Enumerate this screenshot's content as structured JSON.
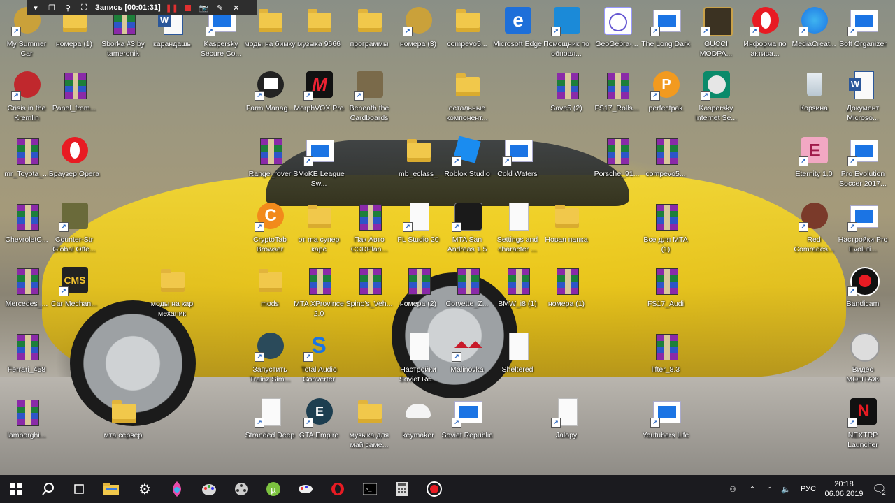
{
  "recorder": {
    "title": "Запись [00:01:31]",
    "icons": [
      "chevron-down-icon",
      "restore-window-icon",
      "search-icon",
      "region-select-icon",
      "pause-icon",
      "stop-icon",
      "camera-icon",
      "pen-icon",
      "close-icon"
    ]
  },
  "icons": [
    {
      "id": "my-summer-car",
      "label": "My Summer Car",
      "icon": "game-icon",
      "col": 0,
      "row": 0,
      "shortcut": true
    },
    {
      "id": "nomera-1",
      "label": "номера (1)",
      "icon": "folder",
      "col": 1,
      "row": 0
    },
    {
      "id": "sborka-3",
      "label": "Sborka #3 by tameronik",
      "icon": "winrar",
      "col": 2,
      "row": 0
    },
    {
      "id": "karandash",
      "label": "карандашь",
      "icon": "word",
      "col": 3,
      "row": 0
    },
    {
      "id": "kaspersky-secure",
      "label": "Kaspersky Secure Co...",
      "icon": "appwin",
      "col": 4,
      "row": 0,
      "shortcut": true
    },
    {
      "id": "mody-na-bimku",
      "label": "моды на бимку",
      "icon": "folder",
      "col": 5,
      "row": 0
    },
    {
      "id": "muzyka-9666",
      "label": "музыка 9666",
      "icon": "folder",
      "col": 6,
      "row": 0
    },
    {
      "id": "programmy",
      "label": "программы",
      "icon": "folder",
      "col": 7,
      "row": 0
    },
    {
      "id": "nomera-3",
      "label": "номера (3)",
      "icon": "game-icon",
      "col": 8,
      "row": 0,
      "shortcut": true
    },
    {
      "id": "compevo5-a",
      "label": "compevo5...",
      "icon": "folder",
      "col": 9,
      "row": 0
    },
    {
      "id": "edge",
      "label": "Microsoft Edge",
      "icon": "edge",
      "col": 10,
      "row": 0
    },
    {
      "id": "pomoshchnik",
      "label": "Помощник по обновл...",
      "icon": "windows",
      "col": 11,
      "row": 0,
      "shortcut": true
    },
    {
      "id": "geogebra",
      "label": "GeoGebra-...",
      "icon": "geogebra",
      "col": 12,
      "row": 0
    },
    {
      "id": "long-dark",
      "label": "The Long Dark",
      "icon": "appwin",
      "col": 13,
      "row": 0,
      "shortcut": true
    },
    {
      "id": "gucci",
      "label": "GUCCI MODPA...",
      "icon": "gucci",
      "col": 14,
      "row": 0,
      "shortcut": true
    },
    {
      "id": "informa",
      "label": "Информа по актива...",
      "icon": "opera",
      "col": 15,
      "row": 0,
      "shortcut": true
    },
    {
      "id": "mediacreation",
      "label": "MediaCreat...",
      "icon": "mediacreation",
      "col": 16,
      "row": 0,
      "shortcut": true
    },
    {
      "id": "soft-organizer",
      "label": "Soft Organizer",
      "icon": "appwin",
      "col": 17,
      "row": 0,
      "shortcut": true
    },
    {
      "id": "crisis-kremlin",
      "label": "Crisis in the Kremlin",
      "icon": "red-round",
      "col": 0,
      "row": 1,
      "shortcut": true
    },
    {
      "id": "panel-from",
      "label": "Panel_from...",
      "icon": "winrar",
      "col": 1,
      "row": 1
    },
    {
      "id": "farm-manager",
      "label": "Farm Manag...",
      "icon": "farm",
      "col": 5,
      "row": 1,
      "shortcut": true
    },
    {
      "id": "morphvox",
      "label": "MorphVOX Pro",
      "icon": "morphvox",
      "col": 6,
      "row": 1,
      "shortcut": true
    },
    {
      "id": "beneath-cardboards",
      "label": "Beneath the Cardboards",
      "icon": "cardboard",
      "col": 7,
      "row": 1,
      "shortcut": true
    },
    {
      "id": "ostalnye",
      "label": "остальные компонент...",
      "icon": "folder",
      "col": 9,
      "row": 1
    },
    {
      "id": "save5-2",
      "label": "Save5 (2)",
      "icon": "winrar",
      "col": 11,
      "row": 1
    },
    {
      "id": "fs17-rolls",
      "label": "FS17_Rolls...",
      "icon": "winrar",
      "col": 12,
      "row": 1
    },
    {
      "id": "perfectpak",
      "label": "perfectpak",
      "icon": "perfectpak",
      "col": 13,
      "row": 1,
      "shortcut": true
    },
    {
      "id": "kaspersky-is",
      "label": "Kaspersky Internet Se...",
      "icon": "kaspersky",
      "col": 14,
      "row": 1,
      "shortcut": true
    },
    {
      "id": "korzina",
      "label": "Корзина",
      "icon": "recycle",
      "col": 16,
      "row": 1
    },
    {
      "id": "dokument",
      "label": "Документ Microso...",
      "icon": "word",
      "col": 17,
      "row": 1
    },
    {
      "id": "mr-toyota",
      "label": "mr_Toyota_...",
      "icon": "winrar",
      "col": 0,
      "row": 2
    },
    {
      "id": "opera-browser",
      "label": "Браузер Opera",
      "icon": "opera",
      "col": 1,
      "row": 2
    },
    {
      "id": "range-rover",
      "label": "Range_rover",
      "icon": "winrar",
      "col": 5,
      "row": 2
    },
    {
      "id": "smoke-league",
      "label": "SMoKE League Sw...",
      "icon": "appwin",
      "col": 6,
      "row": 2,
      "shortcut": true
    },
    {
      "id": "mb-eclass",
      "label": "mb_eclass_",
      "icon": "folder",
      "col": 8,
      "row": 2
    },
    {
      "id": "roblox",
      "label": "Roblox Studio",
      "icon": "roblox",
      "col": 9,
      "row": 2,
      "shortcut": true
    },
    {
      "id": "cold-waters",
      "label": "Cold Waters",
      "icon": "appwin",
      "col": 10,
      "row": 2,
      "shortcut": true
    },
    {
      "id": "porsche-91",
      "label": "Porsche_91...",
      "icon": "winrar",
      "col": 12,
      "row": 2
    },
    {
      "id": "compevo5-b",
      "label": "compevo5...",
      "icon": "winrar",
      "col": 13,
      "row": 2
    },
    {
      "id": "eternity",
      "label": "Eternity 1.0",
      "icon": "eternity",
      "col": 16,
      "row": 2,
      "shortcut": true
    },
    {
      "id": "pes-2017",
      "label": "Pro Evolution Soccer 2017...",
      "icon": "appwin",
      "col": 17,
      "row": 2,
      "shortcut": true
    },
    {
      "id": "chevrolet",
      "label": "ChevroletC...",
      "icon": "winrar",
      "col": 0,
      "row": 3
    },
    {
      "id": "counter-strike",
      "label": "Counter-Str Global Offe...",
      "icon": "csgo",
      "col": 1,
      "row": 3,
      "shortcut": true
    },
    {
      "id": "cryptotab",
      "label": "CryptoTab Browser",
      "icon": "cryptotab",
      "col": 5,
      "row": 3,
      "shortcut": true
    },
    {
      "id": "ot-ma",
      "label": "от ma супер карс",
      "icon": "folder",
      "col": 6,
      "row": 3
    },
    {
      "id": "pak-avto",
      "label": "Пак Авто CCDPlan...",
      "icon": "winrar",
      "col": 7,
      "row": 3
    },
    {
      "id": "fl-studio",
      "label": "FL Studio 20",
      "icon": "doc",
      "col": 8,
      "row": 3,
      "shortcut": true
    },
    {
      "id": "mta-sa",
      "label": "MTA San Andreas 1.5",
      "icon": "mta",
      "col": 9,
      "row": 3,
      "shortcut": true
    },
    {
      "id": "settings-character",
      "label": "Settings and character ...",
      "icon": "doc",
      "col": 10,
      "row": 3
    },
    {
      "id": "novaya-papka",
      "label": "Новая папка",
      "icon": "folder",
      "col": 11,
      "row": 3
    },
    {
      "id": "vse-dlya-mta",
      "label": "Все для MTA (1)",
      "icon": "winrar",
      "col": 13,
      "row": 3
    },
    {
      "id": "red-comrades",
      "label": "Red Comrades...",
      "icon": "redcomrades",
      "col": 16,
      "row": 3,
      "shortcut": true
    },
    {
      "id": "nastroiki-pes",
      "label": "Настройки Pro Evoluti...",
      "icon": "appwin",
      "col": 17,
      "row": 3,
      "shortcut": true
    },
    {
      "id": "mercedes",
      "label": "Mercedes_...",
      "icon": "winrar",
      "col": 0,
      "row": 4
    },
    {
      "id": "car-mechanic",
      "label": "Car Mechan...",
      "icon": "cms",
      "col": 1,
      "row": 4,
      "shortcut": true
    },
    {
      "id": "mody-na-kar",
      "label": "моды на кар механик",
      "icon": "folder",
      "col": 3,
      "row": 4
    },
    {
      "id": "mods",
      "label": "mods",
      "icon": "folder",
      "col": 5,
      "row": 4
    },
    {
      "id": "mta-xprovince",
      "label": "MTA XProvince 2.0",
      "icon": "winrar",
      "col": 6,
      "row": 4
    },
    {
      "id": "spinos",
      "label": "Spino's_Veh...",
      "icon": "winrar",
      "col": 7,
      "row": 4
    },
    {
      "id": "nomera-2",
      "label": "номера (2)",
      "icon": "winrar",
      "col": 8,
      "row": 4
    },
    {
      "id": "corvette",
      "label": "Corvette_Z...",
      "icon": "winrar",
      "col": 9,
      "row": 4
    },
    {
      "id": "bmw-i8",
      "label": "BMW_i8 (1)",
      "icon": "winrar",
      "col": 10,
      "row": 4
    },
    {
      "id": "nomera-1b",
      "label": "номера (1)",
      "icon": "winrar",
      "col": 11,
      "row": 4
    },
    {
      "id": "fs17-audi",
      "label": "FS17_Audi",
      "icon": "winrar",
      "col": 13,
      "row": 4
    },
    {
      "id": "bandicam",
      "label": "Bandicam",
      "icon": "bandicam",
      "col": 17,
      "row": 4,
      "shortcut": true
    },
    {
      "id": "ferrari-458",
      "label": "Ferrari_458",
      "icon": "winrar",
      "col": 0,
      "row": 5
    },
    {
      "id": "trainz",
      "label": "Запустить Trainz Sim...",
      "icon": "trainz",
      "col": 5,
      "row": 5,
      "shortcut": true
    },
    {
      "id": "total-audio",
      "label": "Total Audio Converter",
      "icon": "totalaudio",
      "col": 6,
      "row": 5,
      "shortcut": true
    },
    {
      "id": "nastroiki-soviet",
      "label": "Настройки Soviet Re...",
      "icon": "doc",
      "col": 8,
      "row": 5
    },
    {
      "id": "malinovka",
      "label": "Malinovka",
      "icon": "malinovka",
      "col": 9,
      "row": 5,
      "shortcut": true
    },
    {
      "id": "sheltered",
      "label": "Sheltered",
      "icon": "doc",
      "col": 10,
      "row": 5
    },
    {
      "id": "lifter",
      "label": "lifter_8.3",
      "icon": "winrar",
      "col": 13,
      "row": 5
    },
    {
      "id": "video-montazh",
      "label": "Видео МОНТАЖ",
      "icon": "filmreel",
      "col": 17,
      "row": 5
    },
    {
      "id": "lamborghini",
      "label": "lamborghi...",
      "icon": "winrar",
      "col": 0,
      "row": 6
    },
    {
      "id": "mta-server",
      "label": "мта сервер",
      "icon": "folder",
      "col": 2,
      "row": 6
    },
    {
      "id": "stranded-deep",
      "label": "Stranded Deep",
      "icon": "doc",
      "col": 5,
      "row": 6,
      "shortcut": true
    },
    {
      "id": "gta-empire",
      "label": "GTA Empire",
      "icon": "gtaempire",
      "col": 6,
      "row": 6,
      "shortcut": true
    },
    {
      "id": "muzyka-dlya",
      "label": "музыка для май саме...",
      "icon": "folder",
      "col": 7,
      "row": 6
    },
    {
      "id": "keymaker",
      "label": "keymaker",
      "icon": "keymaker",
      "col": 8,
      "row": 6
    },
    {
      "id": "soviet-republic",
      "label": "Soviet Republic",
      "icon": "appwin",
      "col": 9,
      "row": 6,
      "shortcut": true
    },
    {
      "id": "jalopy",
      "label": "Jalopy",
      "icon": "doc",
      "col": 11,
      "row": 6,
      "shortcut": true
    },
    {
      "id": "youtubers-life",
      "label": "Youtubers Life",
      "icon": "appwin",
      "col": 13,
      "row": 6,
      "shortcut": true
    },
    {
      "id": "nextrp",
      "label": "NEXTRP Launcher",
      "icon": "nextrp",
      "col": 17,
      "row": 6,
      "shortcut": true
    }
  ],
  "taskbar": {
    "apps": [
      "windows-start-icon",
      "search-icon",
      "task-view-icon",
      "file-explorer-icon",
      "settings-gear-icon",
      "paint-3d-icon",
      "paint-icon",
      "film-reel-icon",
      "utorrent-icon",
      "paint-bucket-icon",
      "opera-icon",
      "terminal-icon",
      "calculator-icon",
      "record-icon"
    ],
    "tray": {
      "language": "РУС",
      "time": "20:18",
      "date": "06.06.2019",
      "notifications": "2"
    }
  },
  "colors": {
    "taskbar": "#1b1b1f",
    "folder": "#f1c84b",
    "accent": "#1b74e4"
  }
}
